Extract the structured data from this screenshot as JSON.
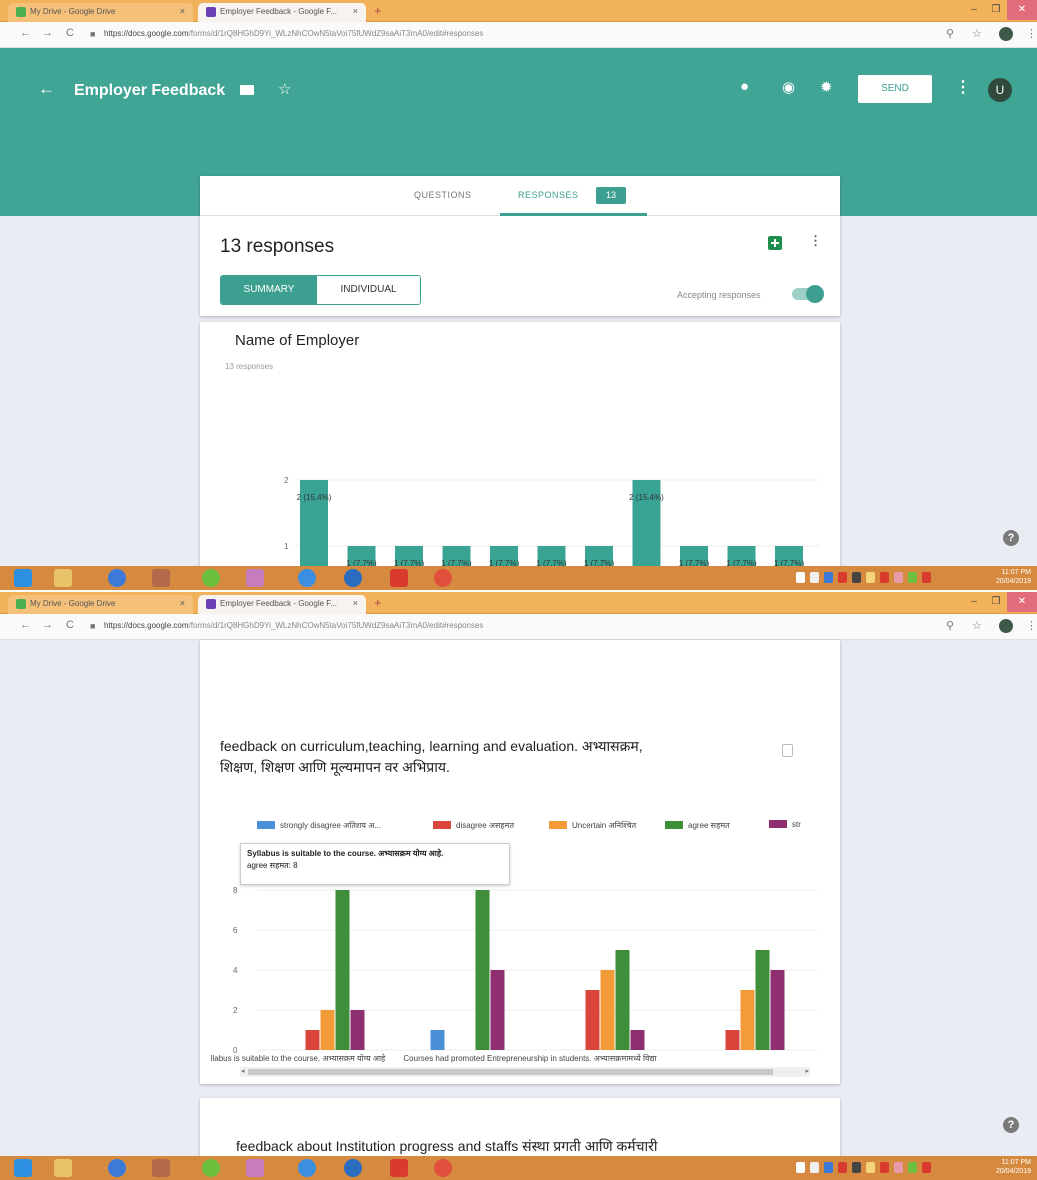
{
  "browser": {
    "tabs": [
      {
        "label": "My Drive - Google Drive",
        "close": "×"
      },
      {
        "label": "Employer Feedback - Google F...",
        "close": "×"
      }
    ],
    "new_tab": "+",
    "window_controls": [
      "–",
      "❐",
      "✕"
    ],
    "url_host": "https://docs.google.com",
    "url_path": "/forms/d/1rQ8HGhD9Yi_WLzNhCOwN5taVoi75fUWdZ9saAiT3mA0/edit#responses"
  },
  "header": {
    "back": "←",
    "title": "Employer Feedback",
    "star": "☆",
    "send_label": "SEND",
    "kebab": "⋮",
    "avatar": "U"
  },
  "tabs": {
    "questions": "QUESTIONS",
    "responses": "RESPONSES",
    "count": "13"
  },
  "summary": {
    "title": "13 responses",
    "summary_btn": "SUMMARY",
    "individual_btn": "INDIVIDUAL",
    "accepting": "Accepting responses",
    "kebab": "⋮"
  },
  "question1": {
    "title": "Name of Employer",
    "subtitle": "13 responses"
  },
  "help": "?",
  "taskbar": {
    "clock_time": "11:07 PM",
    "clock_date": "20/04/2019"
  },
  "question2": {
    "title_line1": "feedback on curriculum,teaching, learning and evaluation. अभ्यासक्रम,",
    "title_line2": "शिक्षण, शिक्षण आणि मूल्यमापन वर अभिप्राय."
  },
  "question3": {
    "title": "feedback about Institution progress and staffs संस्था प्रगती आणि कर्मचारी"
  },
  "tooltip": {
    "line1": "Syllabus is suitable to the course. अभ्यासक्रम योग्य आहे.",
    "line2": "agree सहमत: 8"
  },
  "colors": {
    "teal": "#40a595",
    "bar_teal": "#3aa494",
    "strongly_disagree": "#4a90d9",
    "disagree": "#d9453b",
    "uncertain": "#f29b38",
    "agree": "#3f8f3a",
    "strongly_agree": "#8e2f72"
  },
  "chart_data": [
    {
      "type": "bar",
      "title": "Name of Employer",
      "categories": [
        "",
        "",
        "",
        "",
        "",
        "",
        "",
        "",
        "",
        "",
        ""
      ],
      "values": [
        2,
        1,
        1,
        1,
        1,
        1,
        1,
        2,
        1,
        1,
        1
      ],
      "data_labels": [
        "2 (15.4%)",
        "1 (7.7%)",
        "1 (7.7%)",
        "1 (7.7%)",
        "1 (7.7%)",
        "1 (7.7%)",
        "1 (7.7%)",
        "2 (15.4%)",
        "1 (7.7%)",
        "1 (7.7%)",
        "1 (7.7%)"
      ],
      "yticks": [
        "1",
        "2"
      ],
      "ylim": [
        0,
        2
      ],
      "grid": true
    },
    {
      "type": "bar",
      "categories": [
        "llabus is suitable to the course. अभ्यासक्रम योग्य आहे",
        "",
        "Courses had promoted Entrepreneurship in students. अभ्यासक्रमामध्ये विद्या",
        ""
      ],
      "series": [
        {
          "name": "strongly disagree अतिशय अ...",
          "values": [
            0,
            1,
            0,
            0
          ]
        },
        {
          "name": "disagree असहमत",
          "values": [
            1,
            0,
            3,
            1
          ]
        },
        {
          "name": "Uncertain अनिश्चित",
          "values": [
            2,
            0,
            4,
            3
          ]
        },
        {
          "name": "agree सहमत",
          "values": [
            8,
            8,
            5,
            5
          ]
        },
        {
          "name": "str",
          "values": [
            2,
            4,
            1,
            4
          ]
        }
      ],
      "yticks": [
        "0",
        "2",
        "4",
        "6",
        "8"
      ],
      "ylim": [
        0,
        8
      ],
      "grid": true,
      "legend": "top"
    }
  ]
}
